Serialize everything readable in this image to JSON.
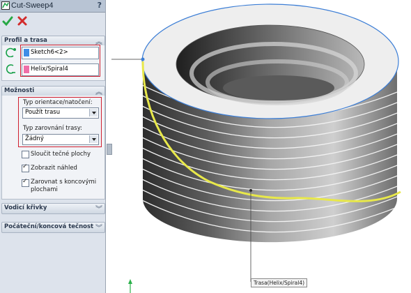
{
  "window": {
    "title": "Cut-Sweep4",
    "help": "?"
  },
  "actions": {
    "ok_label": "OK",
    "cancel_label": "Cancel"
  },
  "profile_path": {
    "header": "Profil a trasa",
    "profile_value": "Sketch6<2>",
    "path_value": "Helix/Spiral4",
    "profile_color": "#3f8ee6",
    "path_color": "#ef6fa8"
  },
  "options": {
    "header": "Možnosti",
    "orientation_label": "Typ orientace/natočení:",
    "orientation_value": "Použít trasu",
    "alignment_label": "Typ zarovnání trasy:",
    "alignment_value": "Žádný",
    "merge_tangent_label": "Sloučit tečné plochy",
    "merge_tangent_checked": false,
    "show_preview_label": "Zobrazit náhled",
    "show_preview_checked": true,
    "align_end_faces_label_1": "Zarovnat s koncovými",
    "align_end_faces_label_2": "plochami",
    "align_end_faces_checked": true
  },
  "guide_curves": {
    "header": "Vodicí křivky"
  },
  "start_end": {
    "header": "Počáteční/koncová tečnost"
  },
  "viewport": {
    "callout": "Trasa(Helix/Spiral4)"
  },
  "colors": {
    "highlight": "#d01e2e",
    "helix": "#e8e84a",
    "edge": "#3c7ed6"
  }
}
